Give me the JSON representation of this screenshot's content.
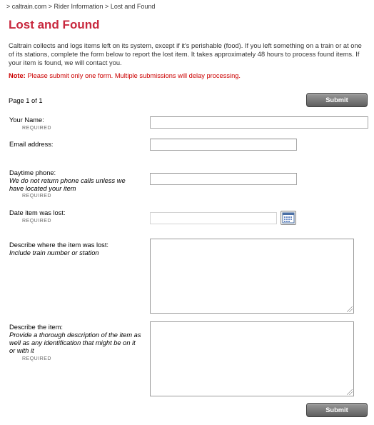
{
  "breadcrumb": "> caltrain.com > Rider Information > Lost and Found",
  "page_title": "Lost and Found",
  "intro": "Caltrain collects and logs items left on its system, except if it's perishable (food).  If you left something on a train or at one of its stations, complete the form below to report the lost item.  It takes approximately 48 hours to process found items.  If your item is found, we will contact you.",
  "note": {
    "prefix": "Note:",
    "text": " Please submit only one form.  Multiple submissions will delay processing."
  },
  "page_indicator": "Page 1 of 1",
  "submit_label": "Submit",
  "required_text": "REQUIRED",
  "fields": {
    "name": {
      "label": "Your Name:",
      "value": ""
    },
    "email": {
      "label": "Email address:",
      "value": ""
    },
    "phone": {
      "label": "Daytime phone:",
      "hint": "We do not return phone calls unless we have located your item",
      "value": ""
    },
    "date": {
      "label": "Date item was lost:",
      "value": "",
      "icon": "calendar-icon"
    },
    "location": {
      "label": "Describe where the item was lost:",
      "hint": "Include train number or station",
      "value": ""
    },
    "item": {
      "label": "Describe the item:",
      "hint": "Provide a thorough description of the item as well as any identification that might be on it or with it",
      "value": ""
    }
  },
  "colors": {
    "title": "#c8283e",
    "note": "#cc0000",
    "button": "#6e6e6e"
  }
}
